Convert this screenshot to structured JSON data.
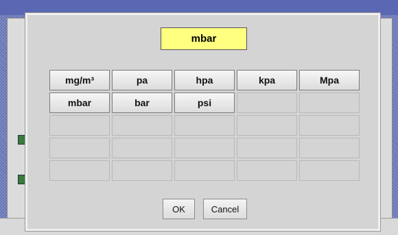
{
  "dialog": {
    "selected_value": "mbar",
    "units": [
      [
        "mg/m³",
        "pa",
        "hpa",
        "kpa",
        "Mpa"
      ],
      [
        "mbar",
        "bar",
        "psi",
        "",
        ""
      ],
      [
        "",
        "",
        "",
        "",
        ""
      ],
      [
        "",
        "",
        "",
        "",
        ""
      ],
      [
        "",
        "",
        "",
        "",
        ""
      ]
    ],
    "ok_label": "OK",
    "cancel_label": "Cancel"
  },
  "colors": {
    "display_bg": "#ffff80",
    "dialog_bg": "#d4d4d4",
    "desktop_bg": "#6d79bd"
  }
}
